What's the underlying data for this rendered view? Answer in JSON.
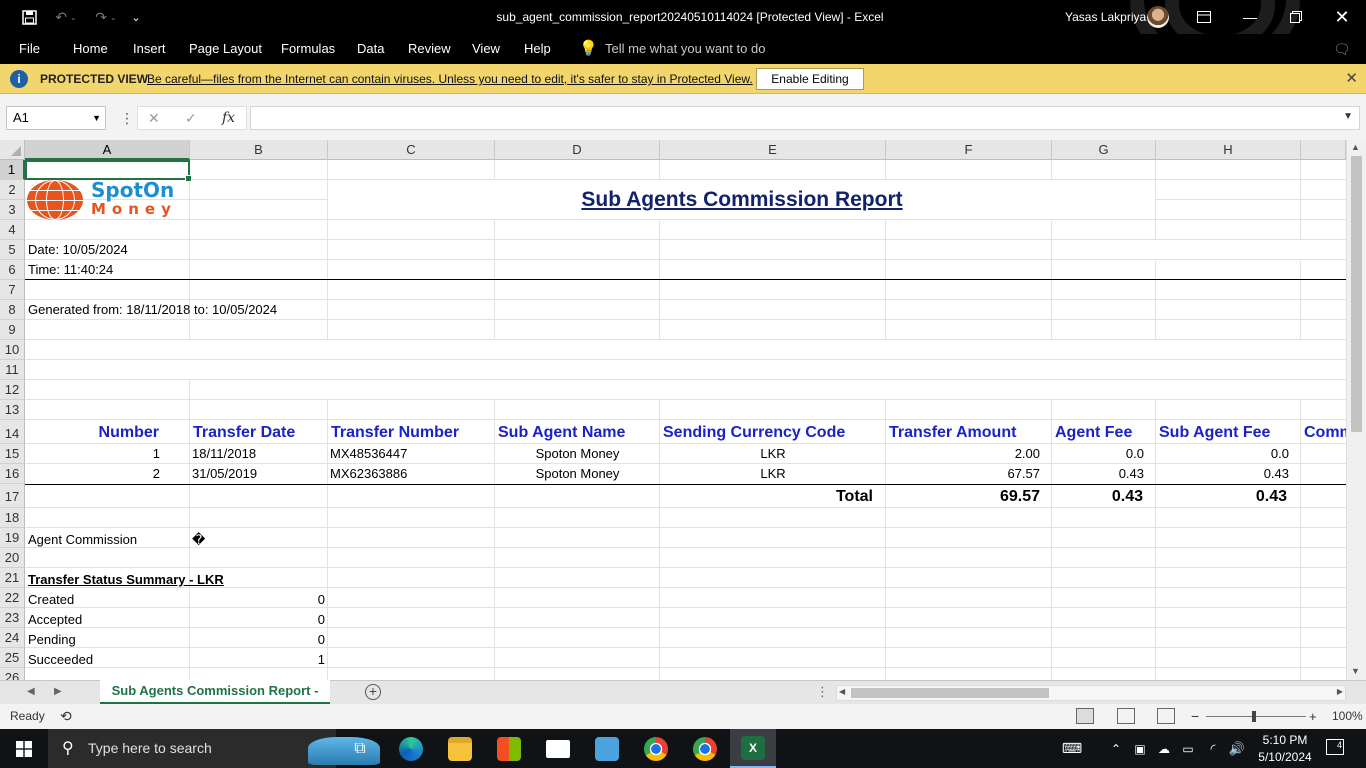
{
  "window": {
    "title": "sub_agent_commission_report20240510114024  [Protected View]  -  Excel",
    "user": "Yasas Lakpriya"
  },
  "menu": {
    "file": "File",
    "home": "Home",
    "insert": "Insert",
    "page_layout": "Page Layout",
    "formulas": "Formulas",
    "data": "Data",
    "review": "Review",
    "view": "View",
    "help": "Help",
    "tell_me": "Tell me what you want to do"
  },
  "protected_view": {
    "label": "PROTECTED VIEW",
    "message": "Be careful—files from the Internet can contain viruses. Unless you need to edit, it's safer to stay in Protected View.",
    "enable_button": "Enable Editing"
  },
  "formula_bar": {
    "name_box": "A1",
    "formula": ""
  },
  "columns": [
    "A",
    "B",
    "C",
    "D",
    "E",
    "F",
    "G",
    "H"
  ],
  "rows": [
    "1",
    "2",
    "3",
    "4",
    "5",
    "6",
    "7",
    "8",
    "9",
    "10",
    "11",
    "12",
    "13",
    "14",
    "15",
    "16",
    "17",
    "18",
    "19",
    "20",
    "21",
    "22",
    "23",
    "24",
    "25",
    "26"
  ],
  "sheet": {
    "logo_top": "SpotOn",
    "logo_bottom": "Money",
    "title": "Sub Agents Commission Report",
    "date": "Date: 10/05/2024",
    "time": "Time: 11:40:24",
    "generated": "Generated from: 18/11/2018 to: 10/05/2024",
    "headers": [
      "Number",
      "Transfer Date",
      "Transfer Number",
      "Sub Agent Name",
      "Sending Currency Code",
      "Transfer Amount",
      "Agent Fee",
      "Sub Agent Fee",
      "Comm"
    ],
    "rows": [
      {
        "number": "1",
        "date": "18/11/2018",
        "transfer_number": "MX48536447",
        "sub_agent": "Spoton Money",
        "currency": "LKR",
        "amount": "2.00",
        "agent_fee": "0.0",
        "sub_agent_fee": "0.0"
      },
      {
        "number": "2",
        "date": "31/05/2019",
        "transfer_number": "MX62363886",
        "sub_agent": "Spoton Money",
        "currency": "LKR",
        "amount": "67.57",
        "agent_fee": "0.43",
        "sub_agent_fee": "0.43"
      }
    ],
    "total_label": "Total",
    "total_amount": "69.57",
    "total_agent_fee": "0.43",
    "total_sub_agent_fee": "0.43",
    "agent_commission_label": "Agent Commission",
    "agent_commission_value": "�",
    "status_summary_title": "Transfer Status Summary - LKR",
    "status_summary": [
      {
        "label": "Created",
        "count": "0"
      },
      {
        "label": "Accepted",
        "count": "0"
      },
      {
        "label": "Pending",
        "count": "0"
      },
      {
        "label": "Succeeded",
        "count": "1"
      }
    ]
  },
  "sheet_tab": "Sub Agents Commission Report -",
  "status": {
    "ready": "Ready",
    "zoom": "100%"
  },
  "taskbar": {
    "search_placeholder": "Type here to search",
    "time": "5:10 PM",
    "date": "5/10/2024",
    "notifications": "4"
  },
  "colors": {
    "excel_green": "#217346",
    "header_blue": "#1b22c8",
    "title_navy": "#10236b",
    "protected_yellow": "#f3d56e"
  }
}
